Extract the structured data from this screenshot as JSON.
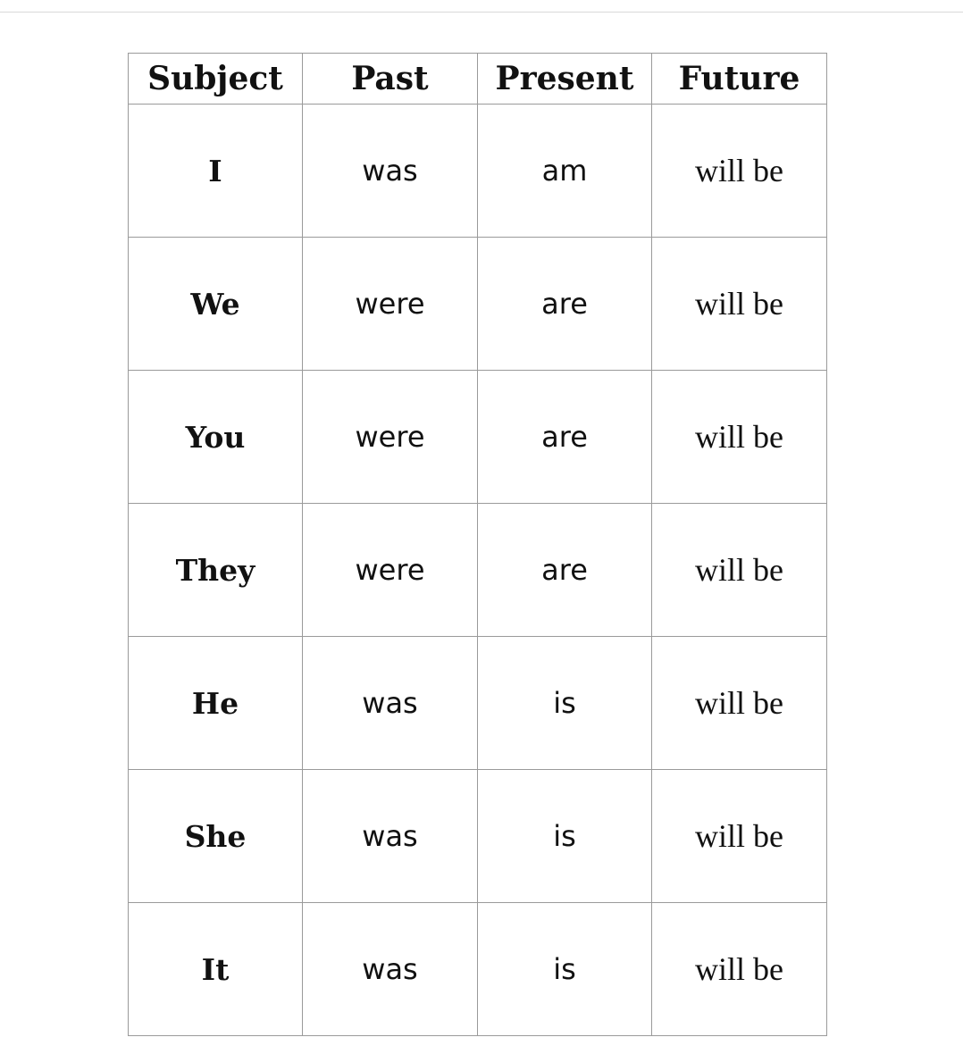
{
  "table": {
    "headers": [
      "Subject",
      "Past",
      "Present",
      "Future"
    ],
    "rows": [
      {
        "subject": "I",
        "past": "was",
        "present": "am",
        "future": "will be"
      },
      {
        "subject": "We",
        "past": "were",
        "present": "are",
        "future": "will be"
      },
      {
        "subject": "You",
        "past": "were",
        "present": "are",
        "future": "will be"
      },
      {
        "subject": "They",
        "past": "were",
        "present": "are",
        "future": "will be"
      },
      {
        "subject": "He",
        "past": "was",
        "present": "is",
        "future": "will be"
      },
      {
        "subject": "She",
        "past": "was",
        "present": "is",
        "future": "will be"
      },
      {
        "subject": "It",
        "past": "was",
        "present": "is",
        "future": "will be"
      }
    ]
  }
}
